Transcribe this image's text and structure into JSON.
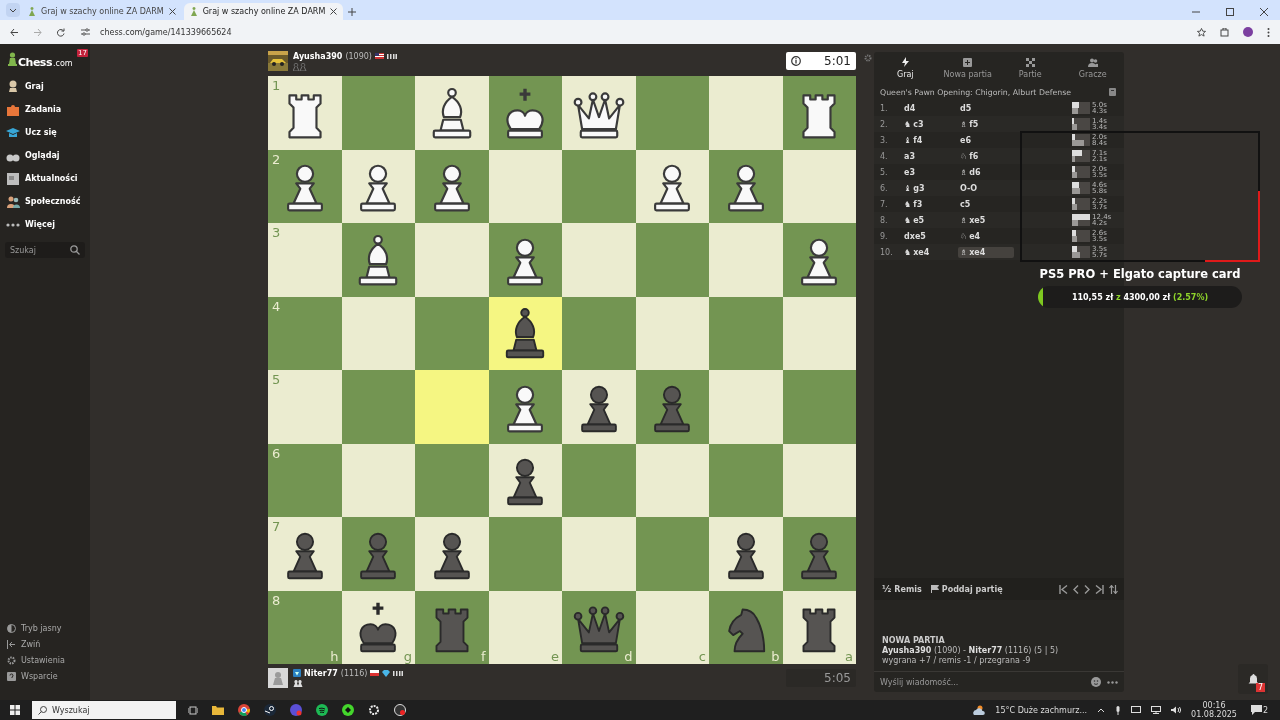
{
  "browser": {
    "tabs": [
      {
        "title": "Graj w szachy online ZA DARM",
        "selected": false
      },
      {
        "title": "Graj w szachy online ZA DARM",
        "selected": true
      }
    ],
    "url": "chess.com/game/141339665624"
  },
  "sidebar": {
    "logo": "Chess",
    "logo_suffix": ".com",
    "badge": "17",
    "items": [
      {
        "label": "Graj"
      },
      {
        "label": "Zadania"
      },
      {
        "label": "Ucz się"
      },
      {
        "label": "Oglądaj"
      },
      {
        "label": "Aktualności"
      },
      {
        "label": "Społeczność"
      },
      {
        "label": "Więcej"
      }
    ],
    "search_placeholder": "Szukaj",
    "footer": [
      {
        "label": "Tryb jasny"
      },
      {
        "label": "Zwiń"
      },
      {
        "label": "Ustawienia"
      },
      {
        "label": "Wsparcie"
      }
    ]
  },
  "top_player": {
    "name": "Ayusha390",
    "rating": "(1090)",
    "clock": "5:01",
    "active": true
  },
  "board": {
    "files": [
      "h",
      "g",
      "f",
      "e",
      "d",
      "c",
      "b",
      "a"
    ],
    "ranks": [
      {
        "label": "1",
        "squares": [
          {
            "kind": "rook",
            "white": true,
            "highlighted": false
          },
          {
            "highlighted": false
          },
          {
            "kind": "bishop",
            "white": true,
            "highlighted": false
          },
          {
            "kind": "king",
            "white": true,
            "highlighted": false
          },
          {
            "kind": "queen",
            "white": true,
            "highlighted": false
          },
          {
            "highlighted": false
          },
          {
            "highlighted": false
          },
          {
            "kind": "rook",
            "white": true,
            "highlighted": false
          }
        ]
      },
      {
        "label": "2",
        "squares": [
          {
            "kind": "pawn",
            "white": true,
            "highlighted": false
          },
          {
            "kind": "pawn",
            "white": true,
            "highlighted": false
          },
          {
            "kind": "pawn",
            "white": true,
            "highlighted": false
          },
          {
            "highlighted": false
          },
          {
            "highlighted": false
          },
          {
            "kind": "pawn",
            "white": true,
            "highlighted": false
          },
          {
            "kind": "pawn",
            "white": true,
            "highlighted": false
          },
          {
            "highlighted": false
          }
        ]
      },
      {
        "label": "3",
        "squares": [
          {
            "highlighted": false
          },
          {
            "kind": "bishop",
            "white": true,
            "highlighted": false
          },
          {
            "highlighted": false
          },
          {
            "kind": "pawn",
            "white": true,
            "highlighted": false
          },
          {
            "highlighted": false
          },
          {
            "highlighted": false
          },
          {
            "highlighted": false
          },
          {
            "kind": "pawn",
            "white": true,
            "highlighted": false
          }
        ]
      },
      {
        "label": "4",
        "squares": [
          {
            "highlighted": false
          },
          {
            "highlighted": false
          },
          {
            "highlighted": false
          },
          {
            "kind": "bishop",
            "white": false,
            "highlighted": true
          },
          {
            "highlighted": false
          },
          {
            "highlighted": false
          },
          {
            "highlighted": false
          },
          {
            "highlighted": false
          }
        ]
      },
      {
        "label": "5",
        "squares": [
          {
            "highlighted": false
          },
          {
            "highlighted": false
          },
          {
            "highlighted": true
          },
          {
            "kind": "pawn",
            "white": true,
            "highlighted": false
          },
          {
            "kind": "pawn",
            "white": false,
            "highlighted": false
          },
          {
            "kind": "pawn",
            "white": false,
            "highlighted": false
          },
          {
            "highlighted": false
          },
          {
            "highlighted": false
          }
        ]
      },
      {
        "label": "6",
        "squares": [
          {
            "highlighted": false
          },
          {
            "highlighted": false
          },
          {
            "highlighted": false
          },
          {
            "kind": "pawn",
            "white": false,
            "highlighted": false
          },
          {
            "highlighted": false
          },
          {
            "highlighted": false
          },
          {
            "highlighted": false
          },
          {
            "highlighted": false
          }
        ]
      },
      {
        "label": "7",
        "squares": [
          {
            "kind": "pawn",
            "white": false,
            "highlighted": false
          },
          {
            "kind": "pawn",
            "white": false,
            "highlighted": false
          },
          {
            "kind": "pawn",
            "white": false,
            "highlighted": false
          },
          {
            "highlighted": false
          },
          {
            "highlighted": false
          },
          {
            "highlighted": false
          },
          {
            "kind": "pawn",
            "white": false,
            "highlighted": false
          },
          {
            "kind": "pawn",
            "white": false,
            "highlighted": false
          }
        ]
      },
      {
        "label": "8",
        "squares": [
          {
            "highlighted": false
          },
          {
            "kind": "king",
            "white": false,
            "highlighted": false
          },
          {
            "kind": "rook",
            "white": false,
            "highlighted": false
          },
          {
            "highlighted": false
          },
          {
            "kind": "queen",
            "white": false,
            "highlighted": false
          },
          {
            "highlighted": false
          },
          {
            "kind": "knight",
            "white": false,
            "highlighted": false
          },
          {
            "kind": "rook",
            "white": false,
            "highlighted": false
          }
        ]
      }
    ]
  },
  "bottom_player": {
    "name": "Niter77",
    "rating": "(1116)",
    "clock": "5:05",
    "active": false
  },
  "panel": {
    "tabs": [
      {
        "label": "Graj",
        "selected": true
      },
      {
        "label": "Nowa partia",
        "selected": false
      },
      {
        "label": "Partie",
        "selected": false
      },
      {
        "label": "Gracze",
        "selected": false
      }
    ],
    "opening": "Queen's Pawn Opening: Chigorin, Alburt Defense",
    "moves": [
      {
        "number": "1.",
        "white": {
          "san": "d4",
          "selected": false
        },
        "black": {
          "san": "d5",
          "selected": false
        },
        "white_time": {
          "text": "5.0s",
          "level": 0.4
        },
        "black_time": {
          "text": "4.3s",
          "level": 0.35
        }
      },
      {
        "number": "2.",
        "white": {
          "figurine": "♞",
          "san": "c3",
          "selected": false
        },
        "black": {
          "figurine": "♗",
          "san": "f5",
          "selected": false
        },
        "white_time": {
          "text": "1.4s",
          "level": 0.11
        },
        "black_time": {
          "text": "3.4s",
          "level": 0.27
        }
      },
      {
        "number": "3.",
        "white": {
          "figurine": "♝",
          "san": "f4",
          "selected": false
        },
        "black": {
          "san": "e6",
          "selected": false
        },
        "white_time": {
          "text": "2.0s",
          "level": 0.16
        },
        "black_time": {
          "text": "8.4s",
          "level": 0.68
        }
      },
      {
        "number": "4.",
        "white": {
          "san": "a3",
          "selected": false
        },
        "black": {
          "figurine": "♘",
          "san": "f6",
          "selected": false
        },
        "white_time": {
          "text": "7.1s",
          "level": 0.57
        },
        "black_time": {
          "text": "2.1s",
          "level": 0.17
        }
      },
      {
        "number": "5.",
        "white": {
          "san": "e3",
          "selected": false
        },
        "black": {
          "figurine": "♗",
          "san": "d6",
          "selected": false
        },
        "white_time": {
          "text": "2.0s",
          "level": 0.16
        },
        "black_time": {
          "text": "3.5s",
          "level": 0.28
        }
      },
      {
        "number": "6.",
        "white": {
          "figurine": "♝",
          "san": "g3",
          "selected": false
        },
        "black": {
          "san": "O-O",
          "selected": false
        },
        "white_time": {
          "text": "4.6s",
          "level": 0.37
        },
        "black_time": {
          "text": "5.8s",
          "level": 0.47
        }
      },
      {
        "number": "7.",
        "white": {
          "figurine": "♞",
          "san": "f3",
          "selected": false
        },
        "black": {
          "san": "c5",
          "selected": false
        },
        "white_time": {
          "text": "2.2s",
          "level": 0.18
        },
        "black_time": {
          "text": "3.7s",
          "level": 0.3
        }
      },
      {
        "number": "8.",
        "white": {
          "figurine": "♞",
          "san": "e5",
          "selected": false
        },
        "black": {
          "figurine": "♗",
          "san": "xe5",
          "selected": false
        },
        "white_time": {
          "text": "12.4s",
          "level": 1
        },
        "black_time": {
          "text": "4.2s",
          "level": 0.34
        }
      },
      {
        "number": "9.",
        "white": {
          "san": "dxe5",
          "selected": false
        },
        "black": {
          "figurine": "♘",
          "san": "e4",
          "selected": false
        },
        "white_time": {
          "text": "2.6s",
          "level": 0.21
        },
        "black_time": {
          "text": "3.5s",
          "level": 0.28
        }
      },
      {
        "number": "10.",
        "white": {
          "figurine": "♞",
          "san": "xe4",
          "selected": false
        },
        "black": {
          "figurine": "♗",
          "san": "xe4",
          "selected": true
        },
        "white_time": {
          "text": "3.5s",
          "level": 0.28
        },
        "black_time": {
          "text": "5.7s",
          "level": 0.46
        }
      }
    ],
    "draw_symbol": "½",
    "draw": "Remis",
    "resign": "Poddaj partię",
    "info_title": "NOWA PARTIA",
    "info_players": "**Ayusha390** (1090) - **Niter77** (1116) (5 | 5)",
    "info_stakes": "wygrana +7 / remis -1 / przegrana -9",
    "chat_placeholder": "Wyślij wiadomość..."
  },
  "donation_goal": {
    "title": "PS5 PRO + Elgato capture card",
    "raised": "110,55 zł",
    "separator": "z",
    "target": "4300,00 zł",
    "percent": "(2.57%)",
    "level": 0.0257
  },
  "notification_count": "7",
  "taskbar": {
    "search_placeholder": "Wyszukaj",
    "weather": "15°C  Duże zachmurz...",
    "time": "00:16",
    "date": "01.08.2025",
    "notifications": "2"
  }
}
